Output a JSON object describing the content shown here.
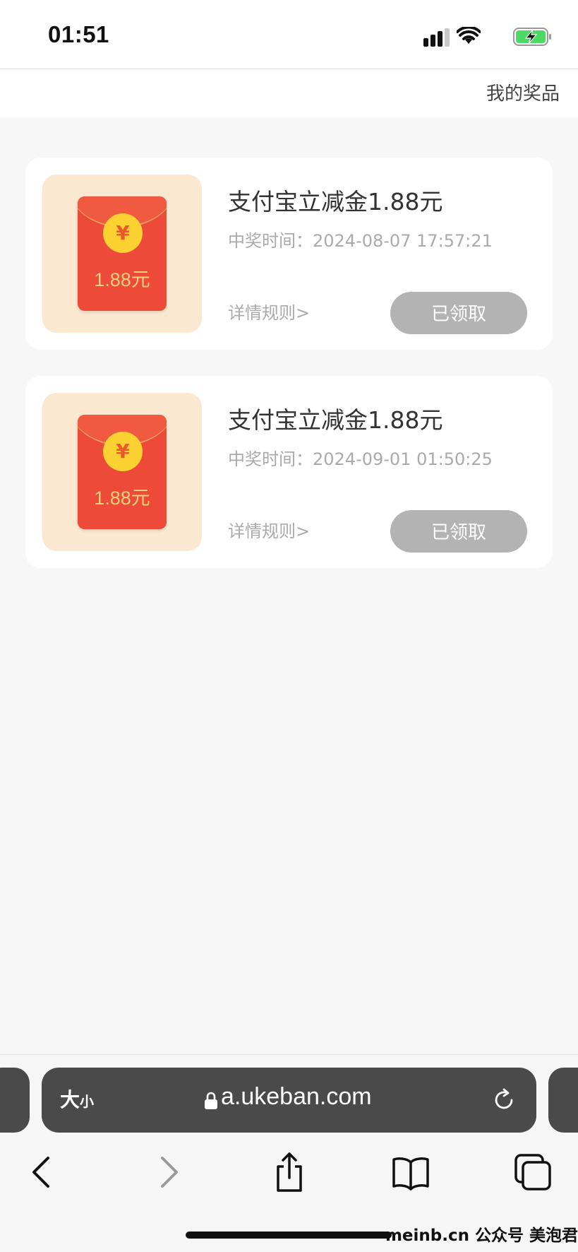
{
  "status_bar": {
    "time": "01:51"
  },
  "header": {
    "my_prizes": "我的奖品"
  },
  "prizes": [
    {
      "title": "支付宝立减金1.88元",
      "time": "中奖时间：2024-08-07 17:57:21",
      "rules": "详情规则>",
      "button": "已领取",
      "coin_symbol": "¥",
      "envelope_amount": "1.88元"
    },
    {
      "title": "支付宝立减金1.88元",
      "time": "中奖时间：2024-09-01 01:50:25",
      "rules": "详情规则>",
      "button": "已领取",
      "coin_symbol": "¥",
      "envelope_amount": "1.88元"
    }
  ],
  "browser": {
    "text_size_big": "大",
    "text_size_small": "小",
    "url": "a.ukeban.com"
  },
  "watermark": "meinb.cn  公众号 美泡君",
  "colors": {
    "envelope_red": "#ee4a3a",
    "coin_yellow": "#fbd232",
    "thumb_bg": "#fbe8d0",
    "claimed_button": "#b3b3b3"
  }
}
